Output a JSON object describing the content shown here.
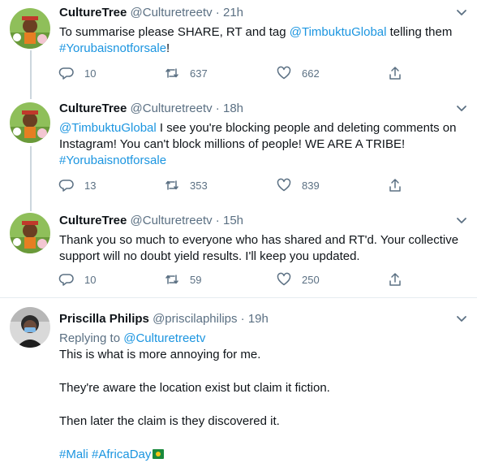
{
  "tweets": [
    {
      "name": "CultureTree",
      "handle": "@Culturetreetv",
      "time": "21h",
      "body": [
        {
          "text": "To summarise please SHARE, RT and tag "
        },
        {
          "text": "@TimbuktuGlobal",
          "link": true
        },
        {
          "text": " telling them "
        },
        {
          "text": "#Yorubaisnotforsale",
          "link": true
        },
        {
          "text": "!"
        }
      ],
      "replies": "10",
      "retweets": "637",
      "likes": "662"
    },
    {
      "name": "CultureTree",
      "handle": "@Culturetreetv",
      "time": "18h",
      "body": [
        {
          "text": "@TimbuktuGlobal",
          "link": true
        },
        {
          "text": " I see you're blocking people and deleting comments on Instagram! You can't block millions of people! WE ARE A TRIBE! "
        },
        {
          "text": "#Yorubaisnotforsale",
          "link": true
        }
      ],
      "replies": "13",
      "retweets": "353",
      "likes": "839"
    },
    {
      "name": "CultureTree",
      "handle": "@Culturetreetv",
      "time": "15h",
      "body": [
        {
          "text": "Thank you so much to everyone who has shared and RT'd. Your collective support will no doubt yield results. I'll keep you updated."
        }
      ],
      "replies": "10",
      "retweets": "59",
      "likes": "250"
    },
    {
      "name": "Priscilla Philips",
      "handle": "@priscilaphilips",
      "time": "19h",
      "replying_label": "Replying to",
      "replying_handle": "@Culturetreetv",
      "paragraphs": [
        "This is what is more annoying for me.",
        "They're aware the location exist but claim it fiction.",
        "Then later the claim is they discovered it."
      ],
      "hashtags": [
        "#Mali",
        "#AfricaDay"
      ]
    }
  ],
  "separator": " · ",
  "colors": {
    "link": "#1b95e0",
    "muted": "#5b7083",
    "rail": "#ccd6dd"
  }
}
